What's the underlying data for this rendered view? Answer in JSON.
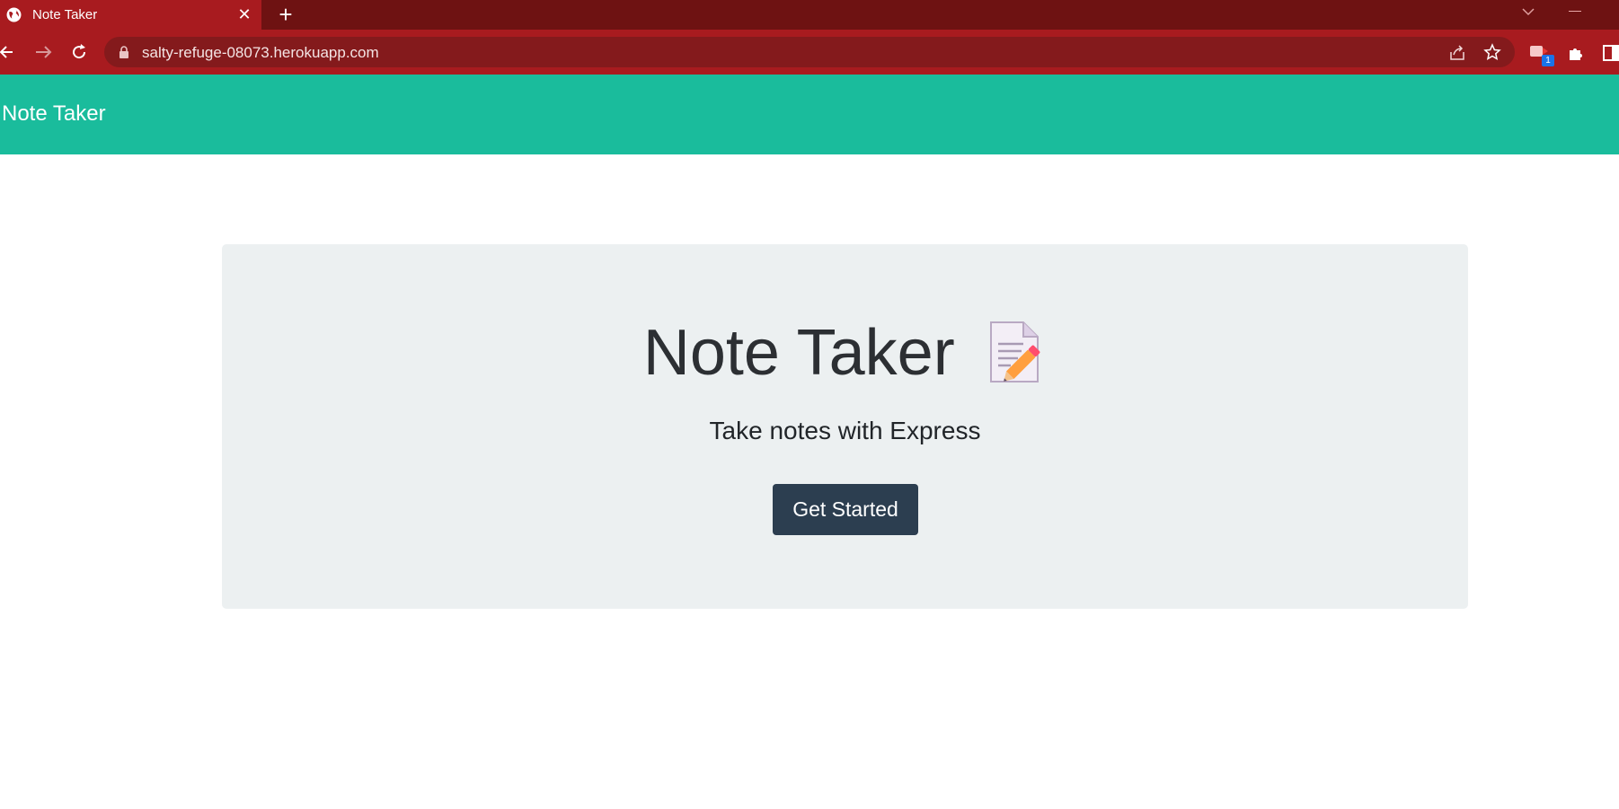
{
  "browser": {
    "tab_title": "Note Taker",
    "url": "salty-refuge-08073.herokuapp.com",
    "extension_badge": "1"
  },
  "navbar": {
    "brand": "Note Taker",
    "background": "#1abc9c"
  },
  "hero": {
    "heading": "Note Taker",
    "heading_icon": "memo-icon",
    "lead": "Take notes with Express",
    "cta_label": "Get Started",
    "cta_color": "#2c3e50"
  }
}
